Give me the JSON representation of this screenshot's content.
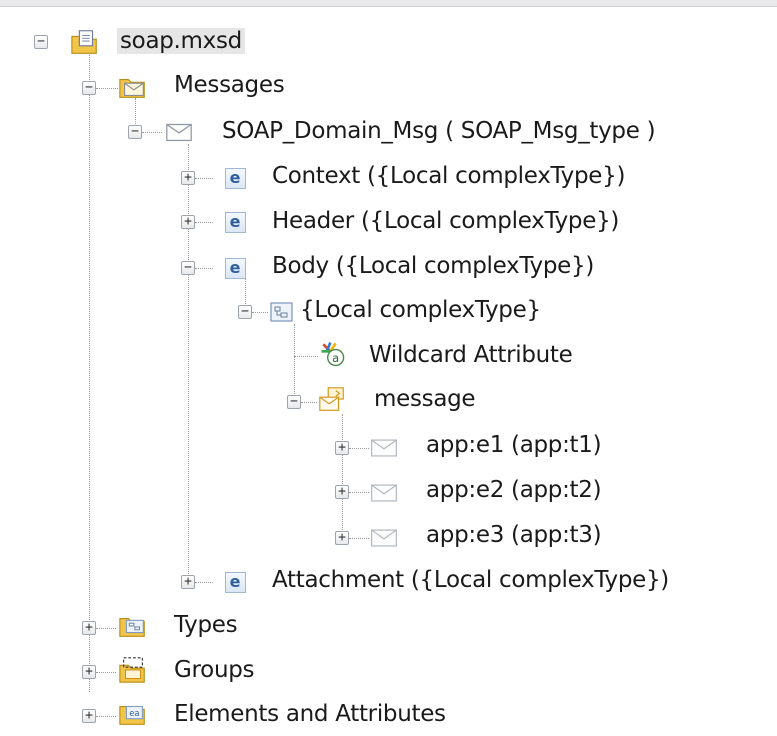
{
  "tree": {
    "root": {
      "label": "soap.mxsd",
      "icon": "schema-file-icon",
      "expanded": true
    },
    "messages": {
      "label": "Messages",
      "icon": "messages-folder-icon",
      "expanded": true
    },
    "soap_msg": {
      "label": "SOAP_Domain_Msg ( SOAP_Msg_type )",
      "icon": "message-envelope-icon",
      "expanded": true
    },
    "context": {
      "label": "Context ({Local complexType})",
      "icon": "element-e-icon",
      "expanded": false
    },
    "header": {
      "label": "Header ({Local complexType})",
      "icon": "element-e-icon",
      "expanded": false
    },
    "body": {
      "label": "Body ({Local complexType})",
      "icon": "element-e-icon",
      "expanded": true
    },
    "local_type": {
      "label": "{Local complexType}",
      "icon": "complex-type-icon",
      "expanded": true
    },
    "wildcard": {
      "label": "Wildcard Attribute",
      "icon": "wildcard-attribute-icon"
    },
    "message": {
      "label": "message",
      "icon": "message-group-icon",
      "expanded": true
    },
    "e1": {
      "label": "app:e1 (app:t1)",
      "icon": "envelope-icon",
      "expanded": false
    },
    "e2": {
      "label": "app:e2 (app:t2)",
      "icon": "envelope-icon",
      "expanded": false
    },
    "e3": {
      "label": "app:e3 (app:t3)",
      "icon": "envelope-icon",
      "expanded": false
    },
    "attachment": {
      "label": "Attachment ({Local complexType})",
      "icon": "element-e-icon",
      "expanded": false
    },
    "types": {
      "label": "Types",
      "icon": "types-folder-icon",
      "expanded": false
    },
    "groups": {
      "label": "Groups",
      "icon": "groups-folder-icon",
      "expanded": false
    },
    "elements": {
      "label": "Elements and Attributes",
      "icon": "elements-folder-icon",
      "expanded": false
    }
  },
  "symbols": {
    "expanded": "−",
    "collapsed": "+",
    "element_letter": "e"
  },
  "colors": {
    "folder": "#f2c447",
    "envelope": "#b7bfc6",
    "element_blue": "#2e5f9c",
    "connector": "#9a9a9a"
  }
}
